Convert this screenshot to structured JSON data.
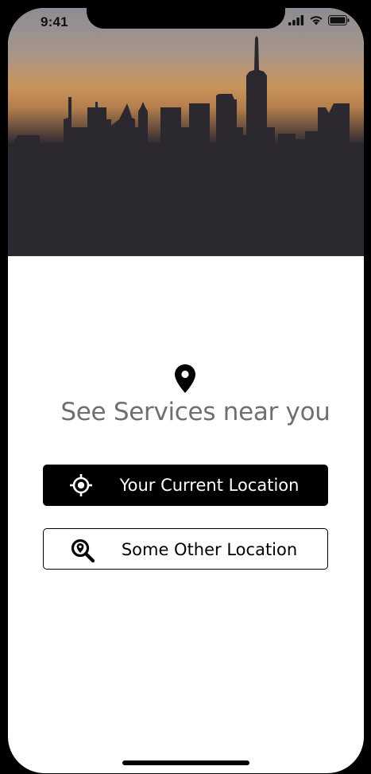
{
  "status_bar": {
    "time": "9:41",
    "icons": [
      "cellular-signal-icon",
      "wifi-icon",
      "battery-icon"
    ]
  },
  "hero": {
    "image": "city-skyline-at-sunset"
  },
  "main": {
    "pin_icon": "map-pin-icon",
    "headline": "See Services near you"
  },
  "buttons": {
    "current_location": {
      "label": "Your Current Location",
      "icon": "crosshair-target-icon",
      "background": "#000000",
      "text_color": "#ffffff"
    },
    "other_location": {
      "label": "Some Other Location",
      "icon": "location-search-icon",
      "background": "#ffffff",
      "text_color": "#000000"
    }
  },
  "colors": {
    "headline": "#6f6f6f",
    "skyline": "#2c2830"
  }
}
